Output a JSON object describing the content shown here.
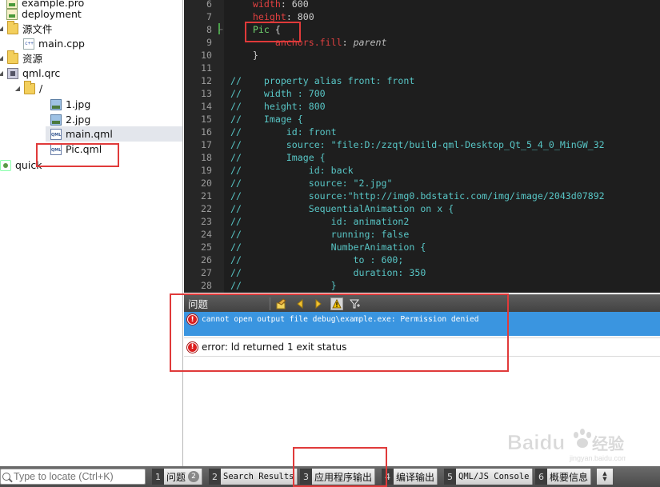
{
  "project_tree": {
    "items": [
      {
        "label": "example.pro",
        "icon": "pro-file-icon",
        "indent": 1
      },
      {
        "label": "deployment",
        "icon": "pro-file-icon",
        "indent": 1
      },
      {
        "label": "源文件",
        "icon": "folder-icon",
        "indent": 1,
        "expanded": true
      },
      {
        "label": "main.cpp",
        "icon": "cpp-file-icon",
        "indent": 2
      },
      {
        "label": "资源",
        "icon": "folder-lock-icon",
        "indent": 1,
        "expanded": true
      },
      {
        "label": "qml.qrc",
        "icon": "qrc-file-icon",
        "indent": 1,
        "expanded": true
      },
      {
        "label": "/",
        "icon": "folder-icon",
        "indent": 2,
        "expanded": true
      },
      {
        "label": "1.jpg",
        "icon": "image-file-icon",
        "indent": 3
      },
      {
        "label": "2.jpg",
        "icon": "image-file-icon",
        "indent": 3
      },
      {
        "label": "main.qml",
        "icon": "qml-file-icon",
        "indent": 3,
        "selected": true
      },
      {
        "label": "Pic.qml",
        "icon": "qml-file-icon",
        "indent": 3
      },
      {
        "label": "quick",
        "icon": "quick-project-icon",
        "indent": 0
      }
    ]
  },
  "editor": {
    "lines": [
      {
        "num": "6",
        "segments": [
          {
            "t": "    ",
            "c": ""
          },
          {
            "t": "width",
            "c": "prop"
          },
          {
            "t": ": 600",
            "c": ""
          }
        ]
      },
      {
        "num": "7",
        "segments": [
          {
            "t": "    ",
            "c": ""
          },
          {
            "t": "height",
            "c": "prop"
          },
          {
            "t": ": 800",
            "c": ""
          }
        ]
      },
      {
        "num": "8",
        "segments": [
          {
            "t": "    ",
            "c": ""
          },
          {
            "t": "Pic",
            "c": "typ"
          },
          {
            "t": " {",
            "c": ""
          }
        ]
      },
      {
        "num": "9",
        "segments": [
          {
            "t": "        ",
            "c": ""
          },
          {
            "t": "anchors.fill",
            "c": "prop"
          },
          {
            "t": ": ",
            "c": ""
          },
          {
            "t": "parent",
            "c": "it"
          }
        ]
      },
      {
        "num": "10",
        "segments": [
          {
            "t": "    }",
            "c": ""
          }
        ]
      },
      {
        "num": "11",
        "segments": []
      },
      {
        "num": "12",
        "segments": [
          {
            "t": "//    property alias front: front",
            "c": "cm"
          }
        ]
      },
      {
        "num": "13",
        "segments": [
          {
            "t": "//    width : 700",
            "c": "cm"
          }
        ]
      },
      {
        "num": "14",
        "segments": [
          {
            "t": "//    height: 800",
            "c": "cm"
          }
        ]
      },
      {
        "num": "15",
        "segments": [
          {
            "t": "//    Image {",
            "c": "cm"
          }
        ]
      },
      {
        "num": "16",
        "segments": [
          {
            "t": "//        id: front",
            "c": "cm"
          }
        ]
      },
      {
        "num": "17",
        "segments": [
          {
            "t": "//        source: \"file:D:/zzqt/build-qml-Desktop_Qt_5_4_0_MinGW_32",
            "c": "cm"
          }
        ]
      },
      {
        "num": "18",
        "segments": [
          {
            "t": "//        Image {",
            "c": "cm"
          }
        ]
      },
      {
        "num": "19",
        "segments": [
          {
            "t": "//            id: back",
            "c": "cm"
          }
        ]
      },
      {
        "num": "20",
        "segments": [
          {
            "t": "//            source: \"2.jpg\"",
            "c": "cm"
          }
        ]
      },
      {
        "num": "21",
        "segments": [
          {
            "t": "//            source:\"http://img0.bdstatic.com/img/image/2043d07892",
            "c": "cm"
          }
        ]
      },
      {
        "num": "22",
        "segments": [
          {
            "t": "//            SequentialAnimation on x {",
            "c": "cm"
          }
        ]
      },
      {
        "num": "23",
        "segments": [
          {
            "t": "//                id: animation2",
            "c": "cm"
          }
        ]
      },
      {
        "num": "24",
        "segments": [
          {
            "t": "//                running: false",
            "c": "cm"
          }
        ]
      },
      {
        "num": "25",
        "segments": [
          {
            "t": "//                NumberAnimation {",
            "c": "cm"
          }
        ]
      },
      {
        "num": "26",
        "segments": [
          {
            "t": "//                    to : 600;",
            "c": "cm"
          }
        ]
      },
      {
        "num": "27",
        "segments": [
          {
            "t": "//                    duration: 350",
            "c": "cm"
          }
        ]
      },
      {
        "num": "28",
        "segments": [
          {
            "t": "//                }",
            "c": "cm"
          }
        ]
      }
    ]
  },
  "issues": {
    "title": "问题",
    "toolbar_icons": [
      "clear-icon",
      "prev-arrow-icon",
      "next-arrow-icon",
      "warning-filter-icon",
      "filter-icon"
    ],
    "items": [
      {
        "text": "cannot open output file debug\\example.exe: Permission denied",
        "severity": "error",
        "selected": true
      },
      {
        "text": "error: ld returned 1 exit status",
        "severity": "error",
        "selected": false
      }
    ]
  },
  "statusbar": {
    "locator_placeholder": "Type to locate (Ctrl+K)",
    "tabs": [
      {
        "num": "1",
        "label": "问题",
        "badge": "2"
      },
      {
        "num": "2",
        "label": "Search Results",
        "mono": true
      },
      {
        "num": "3",
        "label": "应用程序输出"
      },
      {
        "num": "4",
        "label": "编译输出"
      },
      {
        "num": "5",
        "label": "QML/JS Console",
        "mono": true
      },
      {
        "num": "6",
        "label": "概要信息"
      }
    ]
  },
  "watermark": {
    "brand": "Baidu",
    "sub": "经验",
    "url": "jingyan.baidu.com"
  },
  "colors": {
    "editor_bg": "#1e1e1e",
    "comment": "#58c6c6",
    "property": "#e04040",
    "type": "#6fd36f",
    "selected_issue_bg": "#3a95e0",
    "annotation": "#e03a3a"
  }
}
